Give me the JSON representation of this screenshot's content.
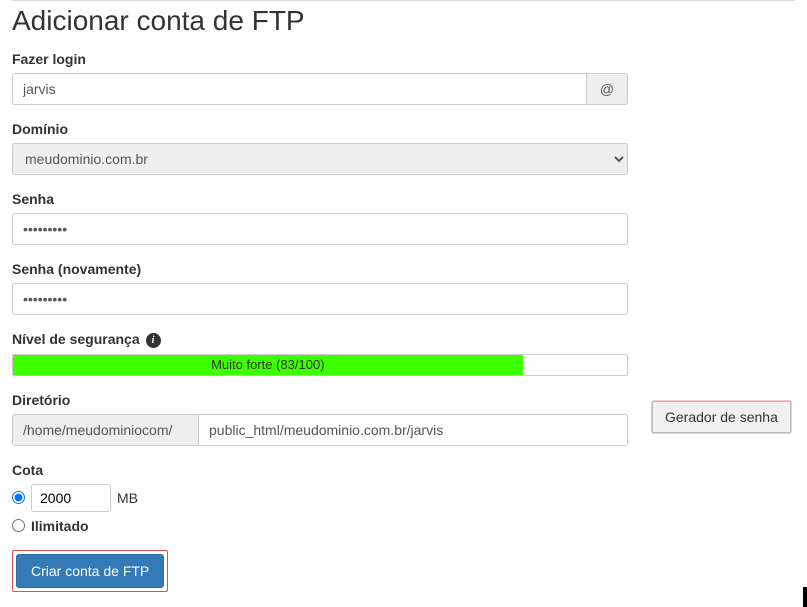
{
  "page_title": "Adicionar conta de FTP",
  "login": {
    "label": "Fazer login",
    "value": "jarvis",
    "suffix": "@"
  },
  "domain": {
    "label": "Domínio",
    "value": "meudominio.com.br"
  },
  "password": {
    "label": "Senha",
    "value": "•••••••••"
  },
  "password_confirm": {
    "label": "Senha (novamente)",
    "value": "•••••••••"
  },
  "strength": {
    "label": "Nível de segurança",
    "text": "Muito forte (83/100)",
    "percent": 83
  },
  "password_generator": {
    "label": "Gerador de senha"
  },
  "directory": {
    "label": "Diretório",
    "prefix": "/home/meudominiocom/",
    "value": "public_html/meudominio.com.br/jarvis"
  },
  "quota": {
    "label": "Cota",
    "value": "2000",
    "unit": "MB",
    "unlimited_label": "Ilimitado"
  },
  "submit": {
    "label": "Criar conta de FTP"
  }
}
